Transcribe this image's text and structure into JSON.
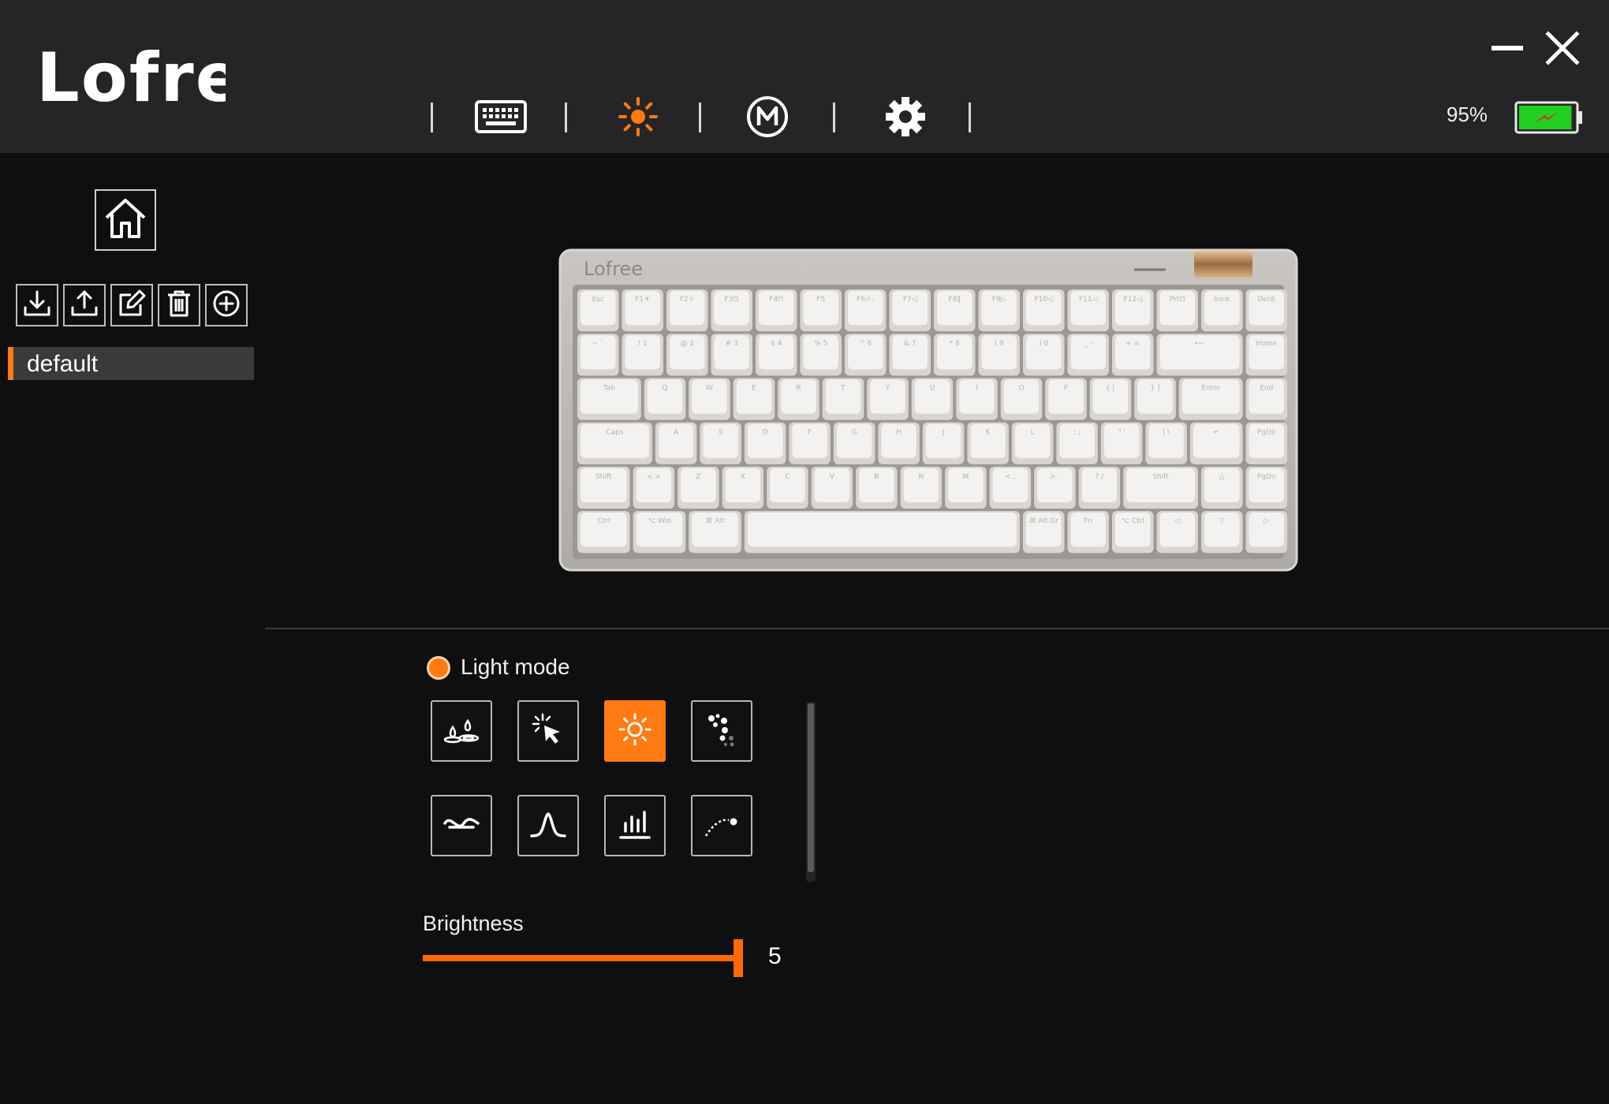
{
  "app": {
    "logo_text": "Lofree"
  },
  "nav": {
    "items": [
      {
        "id": "keyboard",
        "icon": "keyboard-icon",
        "active": false
      },
      {
        "id": "lighting",
        "icon": "sun-icon",
        "active": true
      },
      {
        "id": "macro",
        "icon": "macro-m-icon",
        "active": false
      },
      {
        "id": "settings",
        "icon": "gear-icon",
        "active": false
      }
    ]
  },
  "window": {
    "minimize_icon": "minimize-icon",
    "close_icon": "close-icon"
  },
  "battery": {
    "percent_text": "95%",
    "level": 0.95,
    "charging": true,
    "fill_color": "#1fd01f",
    "bolt_color": "#e8262a"
  },
  "sidebar": {
    "home_icon": "home-icon",
    "tools": [
      "import-icon",
      "export-icon",
      "edit-icon",
      "delete-icon",
      "add-icon"
    ],
    "profiles": [
      {
        "label": "default",
        "selected": true
      }
    ]
  },
  "keyboard": {
    "brand_text": "Lofree",
    "rows": [
      [
        "Esc",
        "F1☀",
        "F2☼",
        "F3⊡",
        "F4⊓",
        "F5",
        "F6☼-",
        "F7◁",
        "F8‖",
        "F9▷",
        "F10◁",
        "F11◁",
        "F12◁",
        "Prt⊡",
        "Ins≡",
        "Del⊘"
      ],
      [
        "~ `",
        "! 1",
        "@ 2",
        "# 3",
        "$ 4",
        "% 5",
        "^ 6",
        "& 7",
        "* 8",
        "( 9",
        ") 0",
        "_ -",
        "+ =",
        "⟵",
        "Home"
      ],
      [
        "Tab",
        "Q",
        "W",
        "E",
        "R",
        "T",
        "Y",
        "U",
        "I",
        "O",
        "P",
        "{ [",
        "} ]",
        "Enter",
        "End"
      ],
      [
        "Caps",
        "A",
        "S",
        "D",
        "F",
        "G",
        "H",
        "J",
        "K",
        "L",
        ": ;",
        "\" '",
        "| \\",
        "↵",
        "PgUp"
      ],
      [
        "Shift",
        "< >",
        "Z",
        "X",
        "C",
        "V",
        "B",
        "N",
        "M",
        "< ,",
        "> .",
        "? /",
        "Shift",
        "△",
        "PgDn"
      ],
      [
        "Ctrl",
        "⌥ Win",
        "⌘ Alt",
        "",
        "⌘ Alt Gr",
        "Fn",
        "⌥ Ctrl",
        "◁",
        "▽",
        "▷"
      ]
    ]
  },
  "lighting": {
    "title": "Light mode",
    "accent_color": "#ff7a12",
    "modes": [
      {
        "icon": "ripple-icon",
        "active": false
      },
      {
        "icon": "cursor-sparkle-icon",
        "active": false
      },
      {
        "icon": "sun-icon",
        "active": true
      },
      {
        "icon": "scatter-dots-icon",
        "active": false
      },
      {
        "icon": "wave-icon",
        "active": false
      },
      {
        "icon": "peak-icon",
        "active": false
      },
      {
        "icon": "equalizer-icon",
        "active": false
      },
      {
        "icon": "arc-icon",
        "active": false
      }
    ],
    "brightness": {
      "label": "Brightness",
      "value": "5",
      "level": 1.0
    }
  }
}
